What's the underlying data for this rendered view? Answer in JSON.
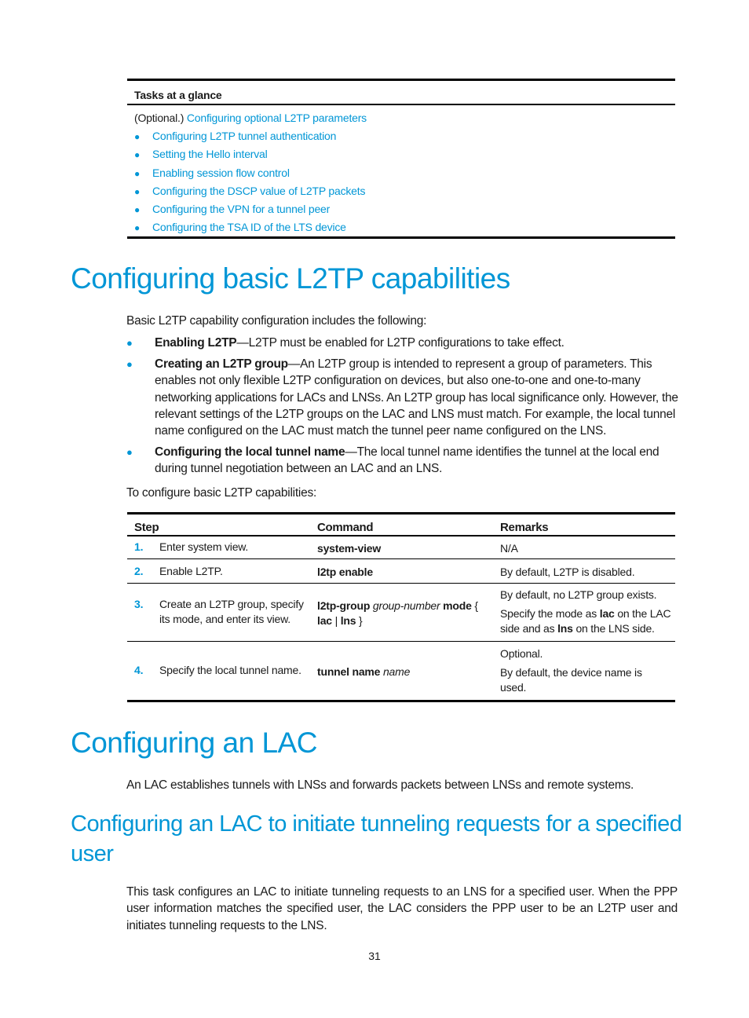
{
  "glance": {
    "header": "Tasks at a glance",
    "optional_prefix": "(Optional.) ",
    "optional_link": "Configuring optional L2TP parameters",
    "items": [
      "Configuring L2TP tunnel authentication",
      "Setting the Hello interval",
      "Enabling session flow control",
      "Configuring the DSCP value of L2TP packets",
      "Configuring the VPN for a tunnel peer",
      "Configuring the TSA ID of the LTS device"
    ]
  },
  "section1": {
    "title": "Configuring basic L2TP capabilities",
    "intro": "Basic L2TP capability configuration includes the following:",
    "bullets": [
      {
        "term": "Enabling L2TP",
        "text": "—L2TP must be enabled for L2TP configurations to take effect."
      },
      {
        "term": "Creating an L2TP group",
        "text": "—An L2TP group is intended to represent a group of parameters. This enables not only flexible L2TP configuration on devices, but also one-to-one and one-to-many networking applications for LACs and LNSs. An L2TP group has local significance only. However, the relevant settings of the L2TP groups on the LAC and LNS must match. For example, the local tunnel name configured on the LAC must match the tunnel peer name configured on the LNS."
      },
      {
        "term": "Configuring the local tunnel name",
        "text": "—The local tunnel name identifies the tunnel at the local end during tunnel negotiation between an LAC and an LNS."
      }
    ],
    "lead": "To configure basic L2TP capabilities:",
    "table": {
      "headers": {
        "step": "Step",
        "command": "Command",
        "remarks": "Remarks"
      },
      "rows": [
        {
          "num": "1.",
          "desc": "Enter system view.",
          "cmd": [
            {
              "t": "system-view",
              "s": "b"
            }
          ],
          "remarks": [
            "N/A"
          ]
        },
        {
          "num": "2.",
          "desc": "Enable L2TP.",
          "cmd": [
            {
              "t": "l2tp enable",
              "s": "b"
            }
          ],
          "remarks": [
            "By default, L2TP is disabled."
          ]
        },
        {
          "num": "3.",
          "desc": "Create an L2TP group, specify its mode, and enter its view.",
          "cmd": [
            {
              "t": "l2tp-group",
              "s": "b"
            },
            {
              "t": " ",
              "s": ""
            },
            {
              "t": "group-number",
              "s": "i"
            },
            {
              "t": " ",
              "s": ""
            },
            {
              "t": "mode",
              "s": "b"
            },
            {
              "t": " { ",
              "s": ""
            },
            {
              "t": "lac",
              "s": "b"
            },
            {
              "t": " | ",
              "s": ""
            },
            {
              "t": "lns",
              "s": "b"
            },
            {
              "t": " }",
              "s": ""
            }
          ],
          "remarks_rich": [
            [
              {
                "t": "By default, no L2TP group exists.",
                "s": ""
              }
            ],
            [
              {
                "t": "Specify the mode as ",
                "s": ""
              },
              {
                "t": "lac",
                "s": "b"
              },
              {
                "t": " on the LAC side and as ",
                "s": ""
              },
              {
                "t": "lns",
                "s": "b"
              },
              {
                "t": " on the LNS side.",
                "s": ""
              }
            ]
          ]
        },
        {
          "num": "4.",
          "desc": "Specify the local tunnel name.",
          "cmd": [
            {
              "t": "tunnel name",
              "s": "b"
            },
            {
              "t": " ",
              "s": ""
            },
            {
              "t": "name",
              "s": "i"
            }
          ],
          "remarks": [
            "Optional.",
            "By default, the device name is used."
          ]
        }
      ]
    }
  },
  "section2": {
    "title": "Configuring an LAC",
    "intro": "An LAC establishes tunnels with LNSs and forwards packets between LNSs and remote systems."
  },
  "section3": {
    "title": "Configuring an LAC to initiate tunneling requests for a specified user",
    "body": "This task configures an LAC to initiate tunneling requests to an LNS for a specified user. When the PPP user information matches the specified user, the LAC considers the PPP user to be an L2TP user and initiates tunneling requests to the LNS."
  },
  "page_number": "31",
  "colors": {
    "accent": "#0096d6",
    "text": "#1a1a1a",
    "rule": "#000000"
  }
}
